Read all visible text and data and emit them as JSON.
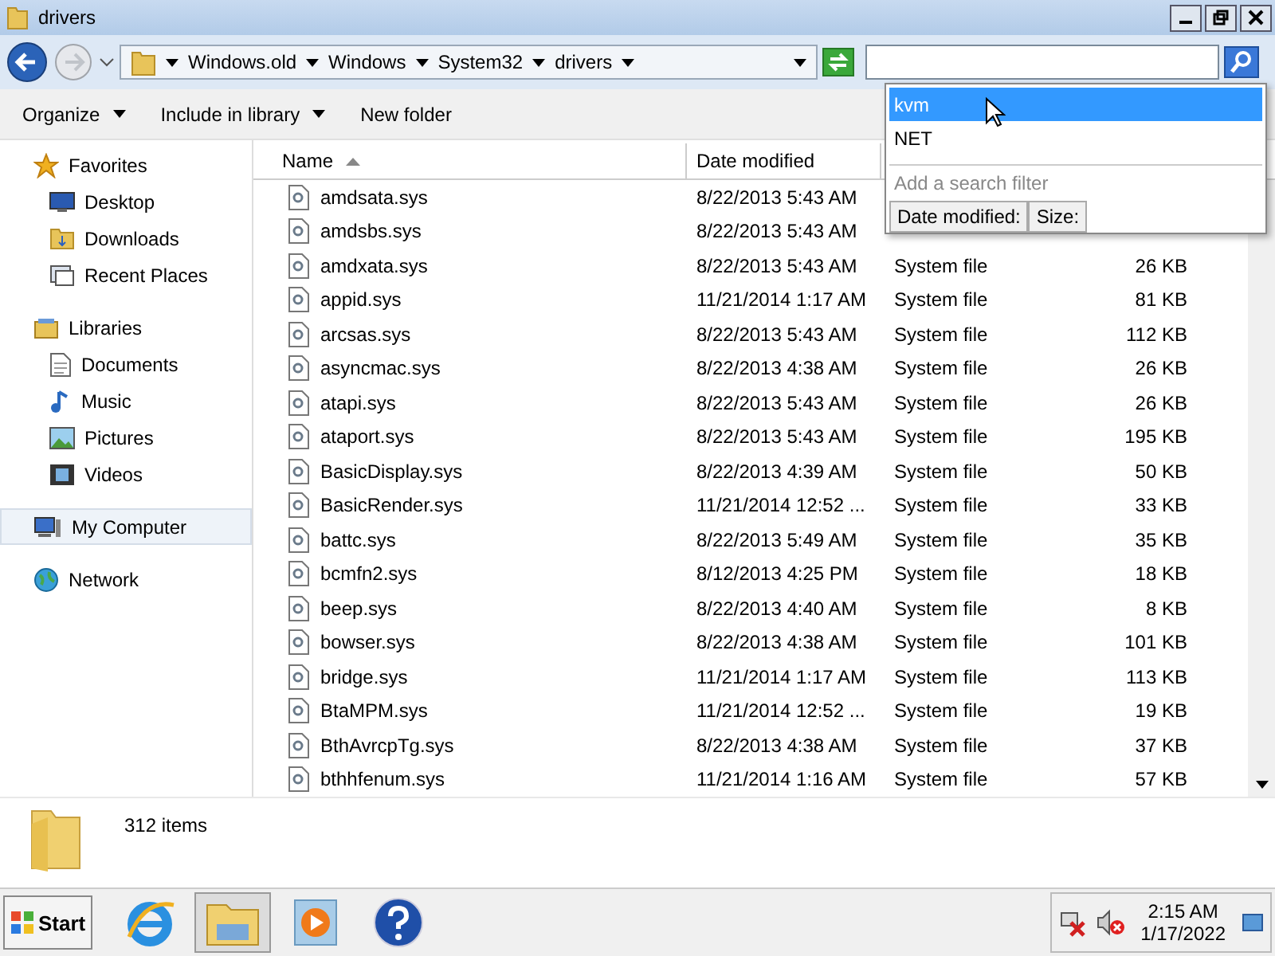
{
  "window": {
    "title": "drivers"
  },
  "address": {
    "crumbs": [
      "Windows.old",
      "Windows",
      "System32",
      "drivers"
    ]
  },
  "toolbar": [
    {
      "label": "Organize",
      "dropdown": true
    },
    {
      "label": "Include in library",
      "dropdown": true
    },
    {
      "label": "New folder",
      "dropdown": false
    }
  ],
  "sidebar": {
    "groups": [
      {
        "label": "Favorites",
        "kind": "star",
        "selected": false,
        "children": [
          {
            "label": "Desktop",
            "kind": "desktop",
            "selected": false
          },
          {
            "label": "Downloads",
            "kind": "folder",
            "selected": false
          },
          {
            "label": "Recent Places",
            "kind": "recent",
            "selected": false
          }
        ]
      },
      {
        "label": "Libraries",
        "kind": "library",
        "selected": false,
        "children": [
          {
            "label": "Documents",
            "kind": "doc",
            "selected": false
          },
          {
            "label": "Music",
            "kind": "music",
            "selected": false
          },
          {
            "label": "Pictures",
            "kind": "pic",
            "selected": false
          },
          {
            "label": "Videos",
            "kind": "video",
            "selected": false
          }
        ]
      },
      {
        "label": "My Computer",
        "kind": "computer",
        "selected": true
      },
      {
        "label": "Network",
        "kind": "network",
        "selected": false
      }
    ]
  },
  "table": {
    "columns": [
      "Name",
      "Date modified"
    ],
    "rows": [
      {
        "name": "amdsata.sys",
        "date": "8/22/2013 5:43 AM"
      },
      {
        "name": "amdsbs.sys",
        "date": "8/22/2013 5:43 AM"
      },
      {
        "name": "amdxata.sys",
        "date": "8/22/2013 5:43 AM",
        "type": "System file",
        "size": "26 KB"
      },
      {
        "name": "appid.sys",
        "date": "11/21/2014 1:17 AM",
        "type": "System file",
        "size": "81 KB"
      },
      {
        "name": "arcsas.sys",
        "date": "8/22/2013 5:43 AM",
        "type": "System file",
        "size": "112 KB"
      },
      {
        "name": "asyncmac.sys",
        "date": "8/22/2013 4:38 AM",
        "type": "System file",
        "size": "26 KB"
      },
      {
        "name": "atapi.sys",
        "date": "8/22/2013 5:43 AM",
        "type": "System file",
        "size": "26 KB"
      },
      {
        "name": "ataport.sys",
        "date": "8/22/2013 5:43 AM",
        "type": "System file",
        "size": "195 KB"
      },
      {
        "name": "BasicDisplay.sys",
        "date": "8/22/2013 4:39 AM",
        "type": "System file",
        "size": "50 KB"
      },
      {
        "name": "BasicRender.sys",
        "date": "11/21/2014 12:52 ...",
        "type": "System file",
        "size": "33 KB"
      },
      {
        "name": "battc.sys",
        "date": "8/22/2013 5:49 AM",
        "type": "System file",
        "size": "35 KB"
      },
      {
        "name": "bcmfn2.sys",
        "date": "8/12/2013 4:25 PM",
        "type": "System file",
        "size": "18 KB"
      },
      {
        "name": "beep.sys",
        "date": "8/22/2013 4:40 AM",
        "type": "System file",
        "size": "8 KB"
      },
      {
        "name": "bowser.sys",
        "date": "8/22/2013 4:38 AM",
        "type": "System file",
        "size": "101 KB"
      },
      {
        "name": "bridge.sys",
        "date": "11/21/2014 1:17 AM",
        "type": "System file",
        "size": "113 KB"
      },
      {
        "name": "BtaMPM.sys",
        "date": "11/21/2014 12:52 ...",
        "type": "System file",
        "size": "19 KB"
      },
      {
        "name": "BthAvrcpTg.sys",
        "date": "8/22/2013 4:38 AM",
        "type": "System file",
        "size": "37 KB"
      },
      {
        "name": "bthhfenum.sys",
        "date": "11/21/2014 1:16 AM",
        "type": "System file",
        "size": "57 KB"
      }
    ]
  },
  "suggestions": {
    "items": [
      {
        "label": "kvm",
        "selected": true
      },
      {
        "label": "NET",
        "selected": false
      }
    ],
    "filter_hint": "Add a search filter",
    "filters": [
      "Date modified:",
      "Size:"
    ]
  },
  "status_bar": {
    "count": "312 items"
  },
  "taskbar": {
    "start": "Start",
    "apps": [
      {
        "kind": "ie",
        "selected": false
      },
      {
        "kind": "explorer",
        "selected": true
      },
      {
        "kind": "media",
        "selected": false
      },
      {
        "kind": "help",
        "selected": false
      }
    ],
    "time": "2:15 AM",
    "date": "1/17/2022"
  }
}
